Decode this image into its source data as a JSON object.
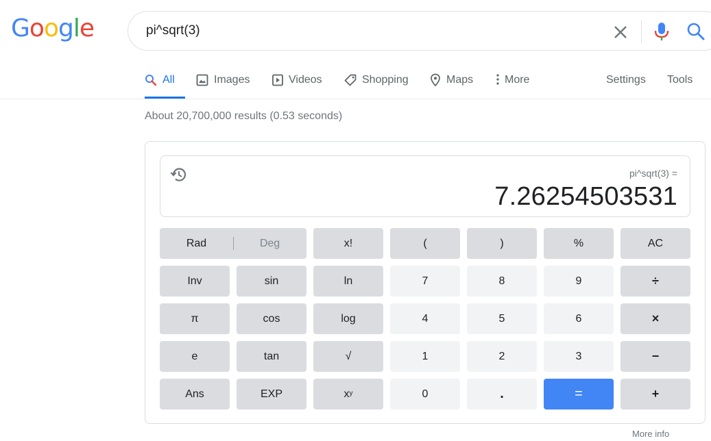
{
  "logo": {
    "letters": [
      {
        "char": "G",
        "color": "#4285F4"
      },
      {
        "char": "o",
        "color": "#EA4335"
      },
      {
        "char": "o",
        "color": "#FBBC05"
      },
      {
        "char": "g",
        "color": "#4285F4"
      },
      {
        "char": "l",
        "color": "#34A853"
      },
      {
        "char": "e",
        "color": "#EA4335"
      }
    ]
  },
  "search": {
    "query": "pi^sqrt(3)",
    "clear_icon": "close-icon",
    "mic_icon": "microphone-icon",
    "search_icon": "search-icon"
  },
  "tabs": {
    "all": "All",
    "images": "Images",
    "videos": "Videos",
    "shopping": "Shopping",
    "maps": "Maps",
    "more": "More",
    "settings": "Settings",
    "tools": "Tools"
  },
  "stats": "About 20,700,000 results (0.53 seconds)",
  "calculator": {
    "expression": "pi^sqrt(3) =",
    "result": "7.26254503531",
    "rad": "Rad",
    "deg": "Deg",
    "keys": {
      "fact": "x!",
      "lparen": "(",
      "rparen": ")",
      "percent": "%",
      "ac": "AC",
      "inv": "Inv",
      "sin": "sin",
      "ln": "ln",
      "seven": "7",
      "eight": "8",
      "nine": "9",
      "divide": "÷",
      "pi": "π",
      "cos": "cos",
      "log": "log",
      "four": "4",
      "five": "5",
      "six": "6",
      "multiply": "×",
      "e": "e",
      "tan": "tan",
      "sqrt": "√",
      "one": "1",
      "two": "2",
      "three": "3",
      "minus": "−",
      "ans": "Ans",
      "exp": "EXP",
      "power_base": "x",
      "power_exp": "y",
      "zero": "0",
      "dot": ".",
      "equals": "=",
      "plus": "+"
    },
    "colors": {
      "function_key": "#dadce0",
      "number_key": "#f1f3f4",
      "equals_key": "#4285f4",
      "accent": "#1a73e8"
    }
  },
  "more_info": "More info"
}
